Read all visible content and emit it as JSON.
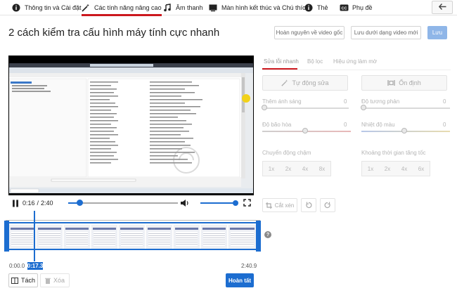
{
  "tabs": [
    {
      "label": "Thông tin và Cài đặt",
      "icon": "info-icon"
    },
    {
      "label": "Các tính năng nâng cao",
      "icon": "magic-wand-icon",
      "active": true
    },
    {
      "label": "Âm thanh",
      "icon": "music-note-icon"
    },
    {
      "label": "Màn hình kết thúc và Chú thích",
      "icon": "end-screen-icon"
    },
    {
      "label": "Thẻ",
      "icon": "info-card-icon"
    },
    {
      "label": "Phụ đề",
      "icon": "cc-icon"
    }
  ],
  "back_icon": "arrow-left-icon",
  "video_title": "2 cách kiểm tra cấu hình máy tính cực nhanh",
  "actions": {
    "revert": "Hoàn nguyên về video gốc",
    "save_new": "Lưu dưới dạng video mới",
    "save": "Lưu"
  },
  "player": {
    "current": "0:16",
    "separator": "/",
    "duration": "2:40",
    "progress": 0.1,
    "volume": 1.0
  },
  "timeline": {
    "start": "0:00.0",
    "end": "2:40.9",
    "playhead": "0:17.3"
  },
  "bottom": {
    "split": "Tách",
    "delete": "Xóa",
    "done": "Hoàn tất"
  },
  "panel": {
    "tabs": [
      "Sửa lỗi nhanh",
      "Bộ lọc",
      "Hiệu ứng làm mờ"
    ],
    "auto_fix": "Tự động sửa",
    "stabilize": "Ổn định",
    "sliders": [
      {
        "label": "Thêm ánh sáng",
        "value": "0"
      },
      {
        "label": "Độ tương phản",
        "value": "0"
      },
      {
        "label": "Độ bão hòa",
        "value": "0"
      },
      {
        "label": "Nhiệt độ màu",
        "value": "0"
      }
    ],
    "slow_motion": "Chuyển động chậm",
    "timelapse": "Khoảng thời gian tăng tốc",
    "speeds": [
      "1x",
      "2x",
      "4x",
      "8x"
    ],
    "lapse_speeds": [
      "1x",
      "2x",
      "4x",
      "6x"
    ],
    "trim": "Cắt xén"
  },
  "colors": {
    "accent": "#1c6dd0",
    "active_tab": "#cc181e"
  }
}
